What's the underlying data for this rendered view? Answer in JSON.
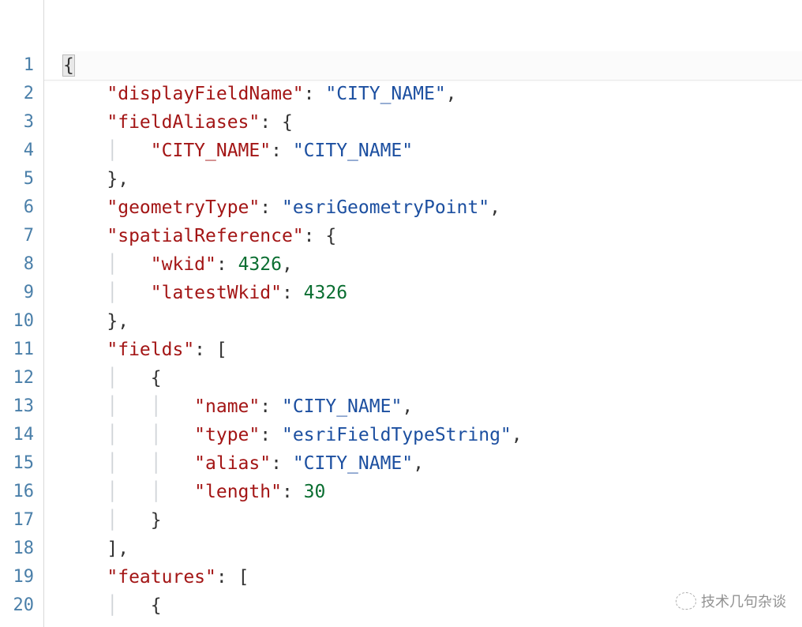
{
  "lineNumbers": [
    "1",
    "2",
    "3",
    "4",
    "5",
    "6",
    "7",
    "8",
    "9",
    "10",
    "11",
    "12",
    "13",
    "14",
    "15",
    "16",
    "17",
    "18",
    "19",
    "20"
  ],
  "code": {
    "l1": "{",
    "l2_key": "\"displayFieldName\"",
    "l2_val": "\"CITY_NAME\"",
    "l3_key": "\"fieldAliases\"",
    "l4_key": "\"CITY_NAME\"",
    "l4_val": "\"CITY_NAME\"",
    "l5": "},",
    "l6_key": "\"geometryType\"",
    "l6_val": "\"esriGeometryPoint\"",
    "l7_key": "\"spatialReference\"",
    "l8_key": "\"wkid\"",
    "l8_val": "4326",
    "l9_key": "\"latestWkid\"",
    "l9_val": "4326",
    "l10": "},",
    "l11_key": "\"fields\"",
    "l12": "{",
    "l13_key": "\"name\"",
    "l13_val": "\"CITY_NAME\"",
    "l14_key": "\"type\"",
    "l14_val": "\"esriFieldTypeString\"",
    "l15_key": "\"alias\"",
    "l15_val": "\"CITY_NAME\"",
    "l16_key": "\"length\"",
    "l16_val": "30",
    "l17": "}",
    "l18": "],",
    "l19_key": "\"features\"",
    "l20": "{"
  },
  "watermark": "技术几句杂谈",
  "json_content": {
    "displayFieldName": "CITY_NAME",
    "fieldAliases": {
      "CITY_NAME": "CITY_NAME"
    },
    "geometryType": "esriGeometryPoint",
    "spatialReference": {
      "wkid": 4326,
      "latestWkid": 4326
    },
    "fields": [
      {
        "name": "CITY_NAME",
        "type": "esriFieldTypeString",
        "alias": "CITY_NAME",
        "length": 30
      }
    ],
    "features": []
  }
}
